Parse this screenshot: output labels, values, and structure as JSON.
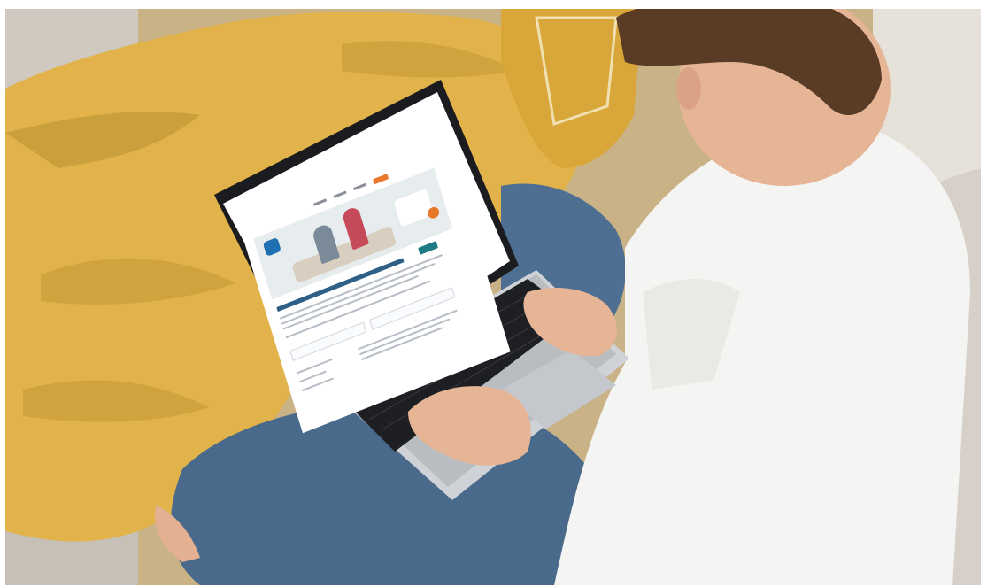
{
  "scene": {
    "description_tags": [
      "photo-background",
      "laptop",
      "person",
      "blanket"
    ],
    "colors": {
      "blanket": "#e4b64a",
      "blanket_shadow": "#c99632",
      "floor": "#c9c2b8",
      "rug": "#cbb58c",
      "jeans": "#4b6a8c",
      "shirt": "#f3f3f1",
      "hair": "#5a3b26",
      "skin": "#e8b99b",
      "laptop_body": "#cfd2d6",
      "laptop_bezel": "#1b1c1f",
      "keyboard": "#1e1f22",
      "cushion": "#d7d2cc",
      "site_accent": "#1f7a84",
      "site_orange": "#e8792b"
    },
    "icons": [
      "laptop-icon"
    ]
  }
}
